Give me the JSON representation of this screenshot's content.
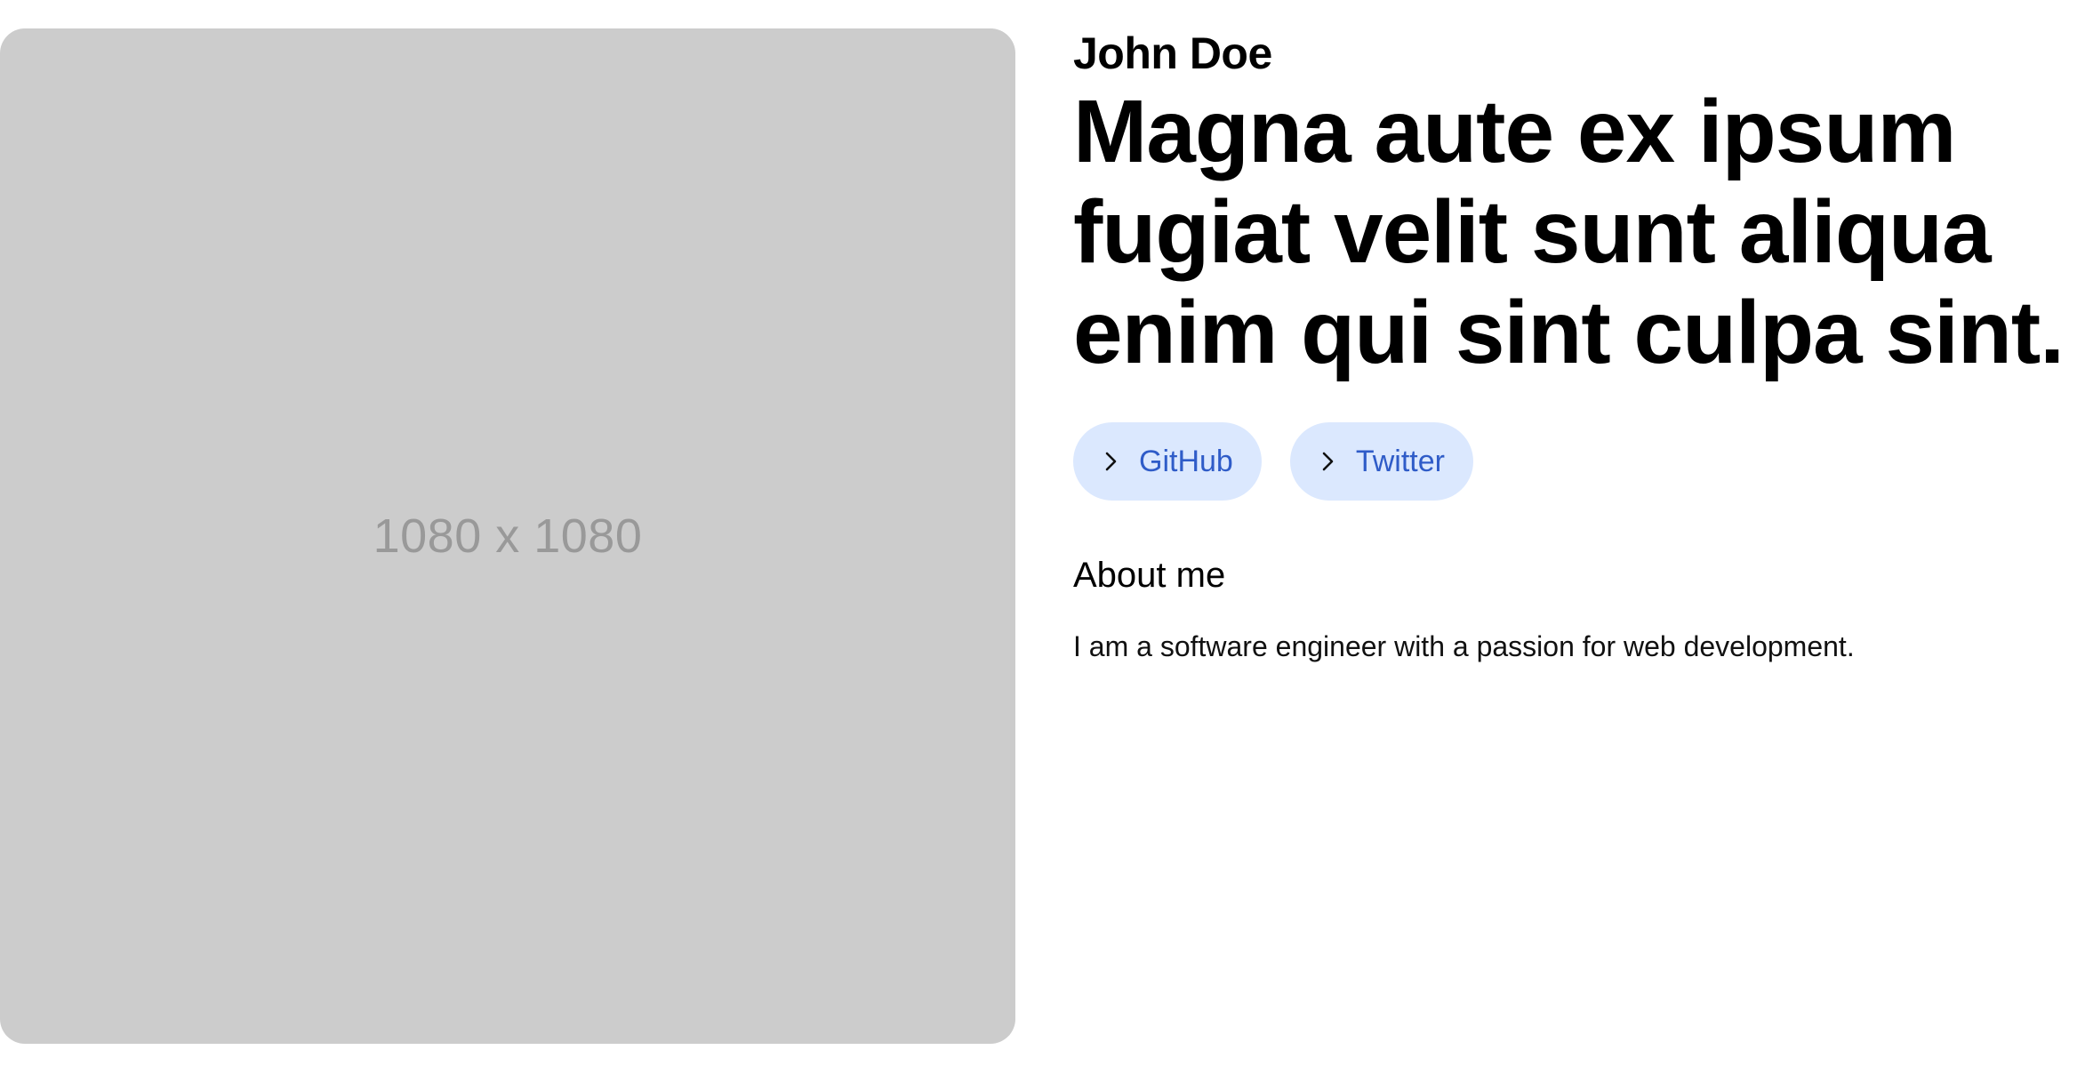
{
  "image_placeholder": {
    "label": "1080 x 1080"
  },
  "profile": {
    "name": "John Doe",
    "headline": [
      "Magna aute ex ipsum",
      "fugiat velit sunt aliqua",
      "enim qui sint culpa sint."
    ]
  },
  "links": [
    {
      "label": "GitHub",
      "icon": "chevron-right-icon"
    },
    {
      "label": "Twitter",
      "icon": "chevron-right-icon"
    }
  ],
  "about": {
    "heading": "About me",
    "text": "I am a software engineer with a passion for web development."
  },
  "colors": {
    "placeholder_bg": "#cccccc",
    "placeholder_text": "#999999",
    "button_bg": "#dbe8fe",
    "button_text": "#2f5cc8"
  }
}
